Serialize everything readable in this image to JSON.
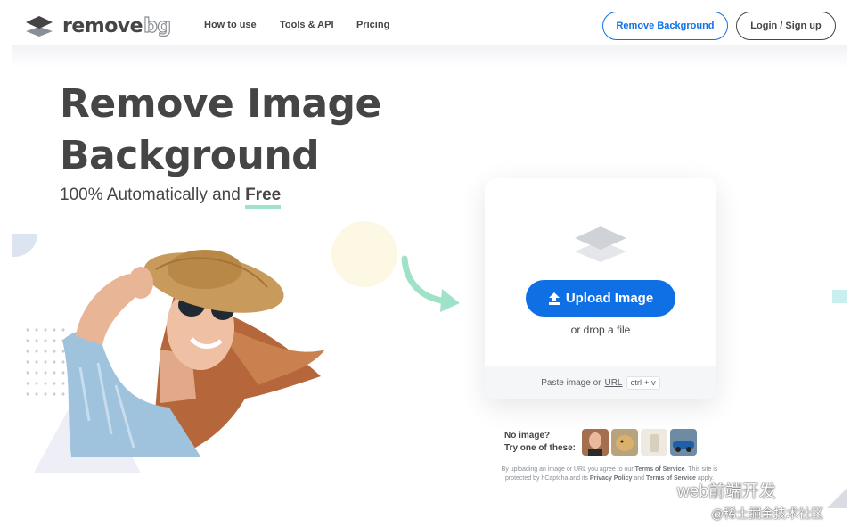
{
  "header": {
    "logo_word": "remove",
    "logo_suffix": "bg",
    "nav": [
      "How to use",
      "Tools & API",
      "Pricing"
    ],
    "remove_bg_button": "Remove Background",
    "login_button": "Login / Sign up"
  },
  "hero": {
    "title_line1": "Remove Image",
    "title_line2": "Background",
    "subtitle_prefix": "100% Automatically and ",
    "subtitle_highlight": "Free"
  },
  "upload": {
    "button_label": "Upload Image",
    "drop_text": "or drop a file",
    "paste_prefix": "Paste image or",
    "paste_url": "URL",
    "key_ctrl": "ctrl",
    "key_plus": "+",
    "key_v": "v"
  },
  "samples": {
    "line1": "No image?",
    "line2": "Try one of these:"
  },
  "terms": {
    "text1": "By uploading an image or URL you agree to our",
    "tos": "Terms of Service",
    "text2": ". This site is protected by hCaptcha and its",
    "privacy": "Privacy Policy",
    "text3": "and",
    "terms2": "Terms of Service",
    "text4": "apply."
  },
  "watermark": {
    "line1": "web前端开发",
    "line2": "@稀土掘金技术社区"
  },
  "colors": {
    "primary": "#0f70e6",
    "text": "#454545",
    "accent_underline": "#9ee3c8",
    "arrow": "#9ee3c8"
  }
}
